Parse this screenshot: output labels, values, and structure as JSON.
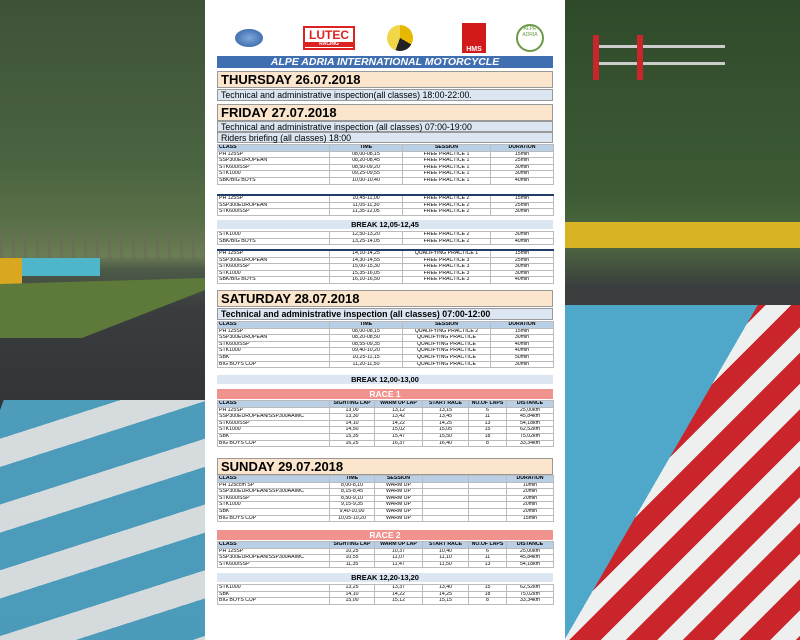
{
  "logos": [
    "LUTEC",
    "RACING",
    "HMS",
    "ALPE ADRIA"
  ],
  "banner": "ALPE ADRIA INTERNATIONAL MOTORCYCLE",
  "thursday": {
    "title": "THURSDAY 26.07.2018",
    "info": "Technical and administrative inspection(all classes) 18:00-22:00."
  },
  "friday": {
    "title": "FRIDAY 27.07.2018",
    "info1": "Technical and administrative inspection (all classes) 07:00-19:00",
    "info2": "Riders briefing (all classes)  18:00",
    "header": [
      "CLASS",
      "TIME",
      "SESSION",
      "DURATION"
    ],
    "block1": [
      [
        "PH 125SP",
        "08,00-08,15",
        "FREE PRACTICE 1",
        "15min"
      ],
      [
        "SSP300EUROPEAN",
        "08,20-08,45",
        "FREE PRACTICE 1",
        "25min"
      ],
      [
        "STK600/SSP",
        "08,50-09,20",
        "FREE PRACTICE 1",
        "30min"
      ],
      [
        "STK1000",
        "09,25-09,55",
        "FREE PRACTICE 1",
        "30min"
      ],
      [
        "SBK/BIG BOYS",
        "10,00-10,40",
        "FREE PRACTICE 1",
        "40min"
      ]
    ],
    "block2": [
      [
        "PH 125SP",
        "10,45-11,00",
        "FREE PRACTICE 2",
        "15min"
      ],
      [
        "SSP300EUROPEAN",
        "11,05-11,30",
        "FREE PRACTICE 2",
        "25min"
      ],
      [
        "STK600/SSP",
        "11,35-12,05",
        "FREE PRACTICE 2",
        "30min"
      ]
    ],
    "break": "BREAK 12,05-12,45",
    "block3": [
      [
        "STK1000",
        "12,50-13,20",
        "FREE PRACTICE 2",
        "30min"
      ],
      [
        "SBK/BIG BOYS",
        "13,25-14,05",
        "FREE PRACTICE 2",
        "40min"
      ]
    ],
    "block4": [
      [
        "PH 125SP",
        "14,10-14,25",
        "QUALIFYING PRACTICE 1",
        "15min"
      ],
      [
        "SSP300EUROPEAN",
        "14,30-14,55",
        "FREE PRACTICE 3",
        "25min"
      ],
      [
        "STK600/SSP",
        "15,00-15,30",
        "FREE PRACTICE 3",
        "30min"
      ],
      [
        "STK1000",
        "15,35-16,05",
        "FREE PRACTICE 3",
        "30min"
      ],
      [
        "SBK/BIG BOYS",
        "16,10-16,50",
        "FREE PRACTICE 3",
        "40min"
      ]
    ]
  },
  "saturday": {
    "title": "SATURDAY 28.07.2018",
    "info": "Technical and administrative inspection (all classes) 07:00-12:00",
    "header": [
      "CLASS",
      "TIME",
      "SESSION",
      "DURATION"
    ],
    "rows": [
      [
        "PH 125SP",
        "08,00-08,15",
        "QUALIFYING PRACTICE 2",
        "15min"
      ],
      [
        "SSP300EUROPEAN",
        "08,20-08,50",
        "QUALIFYING PRACTICE",
        "30min"
      ],
      [
        "STK600/SSP",
        "08,55-09,35",
        "QUALIFYING PRACTICE",
        "40min"
      ],
      [
        "STK1000",
        "09,40-10,20",
        "QUALIFYING PRACTICE",
        "40min"
      ],
      [
        "SBK",
        "10,25-11,15",
        "QUALIFYING PRACTICE",
        "50min"
      ],
      [
        "BIG BOYS CUP",
        "11,20-11,50",
        "QUALIFYING PRACTICE",
        "30min"
      ]
    ],
    "break": "BREAK 12,00-13,00",
    "race_title": "RACE 1",
    "race_header": [
      "CLASS",
      "SIGHTING LAP",
      "WARM UP LAP",
      "START RACE",
      "NO.OF LAPS",
      "DISTANCE"
    ],
    "race_rows": [
      [
        "PH 125SP",
        "13,00",
        "13,12",
        "13,15",
        "6",
        "25,00km"
      ],
      [
        "SSP300EUROPEAN/SSP300AAIMC",
        "13,30",
        "13,42",
        "13,45",
        "11",
        "45,84km"
      ],
      [
        "STK600/SSP",
        "14,10",
        "14,22",
        "14,25",
        "13",
        "54,18km"
      ],
      [
        "STK1000",
        "14,50",
        "15,02",
        "15,05",
        "15",
        "62,52km"
      ],
      [
        "SBK",
        "15,35",
        "15,47",
        "15,50",
        "18",
        "75,02km"
      ],
      [
        "BIG BOYS CUP",
        "16,25",
        "16,37",
        "16,40",
        "8",
        "33,34km"
      ]
    ]
  },
  "sunday": {
    "title": "SUNDAY 29.07.2018",
    "header": [
      "CLASS",
      "TIME",
      "SESSION",
      "",
      "",
      "DURATION"
    ],
    "rows": [
      [
        "PH 125ccm SP",
        "8,00-8,10",
        "WARM UP",
        "",
        "",
        "10min"
      ],
      [
        "SSP300EUROPEAN/SSP300AAIMC",
        "8,15-8,45",
        "WARM UP",
        "",
        "",
        "20min"
      ],
      [
        "STK600/SSP",
        "8,50-9,10",
        "WARM UP",
        "",
        "",
        "20min"
      ],
      [
        "STK1000",
        "9,15-9,35",
        "WARM UP",
        "",
        "",
        "20min"
      ],
      [
        "SBK",
        "9,40-10,00",
        "WARM UP",
        "",
        "",
        "20min"
      ],
      [
        "BIG BOYS CUP",
        "10,05-10,20",
        "WARM UP",
        "",
        "",
        "15min"
      ]
    ],
    "race_title": "RACE 2",
    "race_header": [
      "CLASS",
      "SIGHTING LAP",
      "WARM UP LAP",
      "START RACE",
      "NO.OF LAPS",
      "DISTANCE"
    ],
    "race_rows": [
      [
        "PH 125SP",
        "10,25",
        "10,37",
        "10,40",
        "6",
        "25,00km"
      ],
      [
        "SSP300EUROPEAN/SSP300AAIMC",
        "10,55",
        "11,07",
        "11,10",
        "11",
        "45,84km"
      ],
      [
        "STK600/SSP",
        "11,35",
        "11,47",
        "11,50",
        "13",
        "54,18km"
      ]
    ],
    "break": "BREAK 12,20-13,20",
    "race_rows2": [
      [
        "STK1000",
        "13,25",
        "13,37",
        "13,40",
        "15",
        "62,52km"
      ],
      [
        "SBK",
        "14,10",
        "14,22",
        "14,25",
        "18",
        "75,02km"
      ],
      [
        "BIG BOYS CUP",
        "15,00",
        "15,12",
        "15,15",
        "8",
        "33,34km"
      ]
    ]
  }
}
